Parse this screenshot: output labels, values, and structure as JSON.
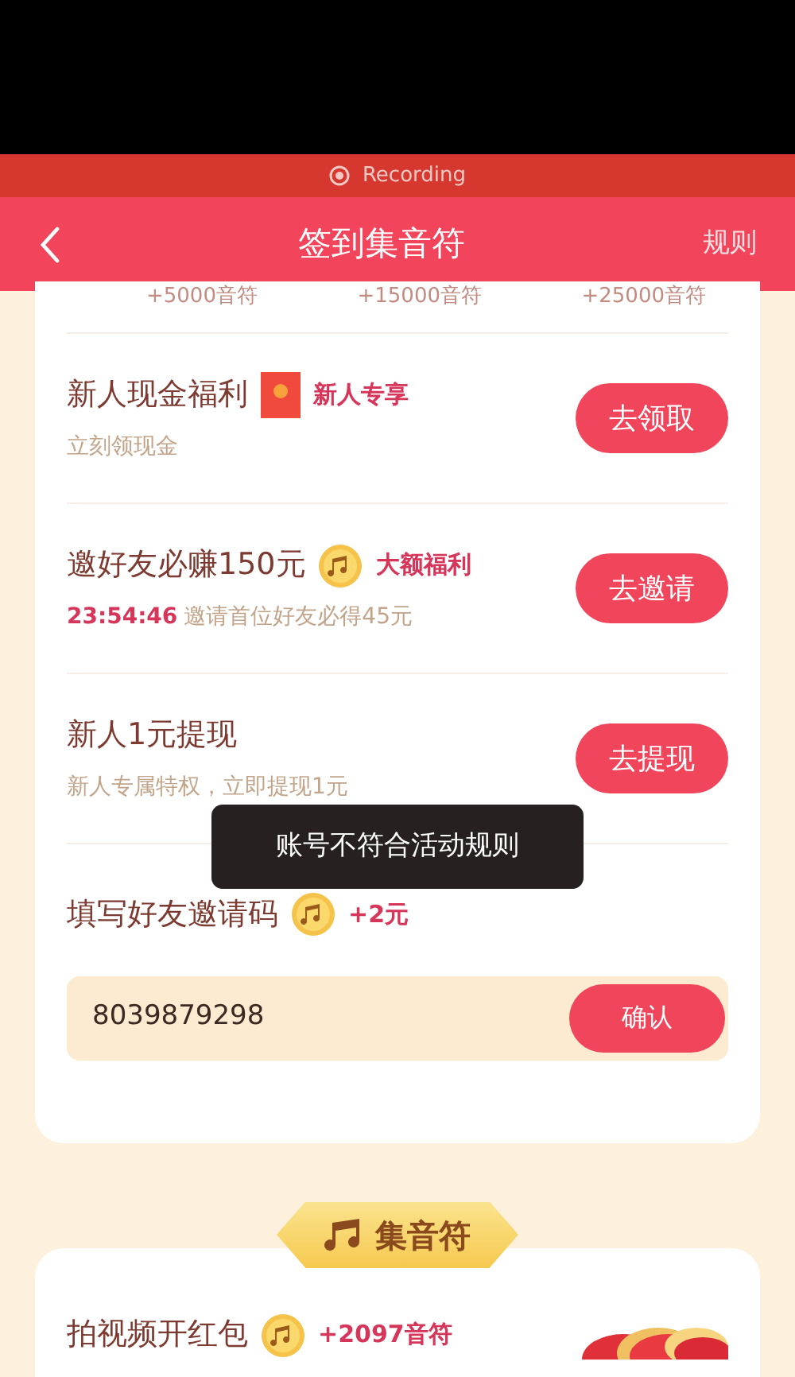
{
  "recording_bar": {
    "label": "Recording"
  },
  "nav": {
    "title": "签到集音符",
    "right": "规则"
  },
  "milestones": [
    "+5000音符",
    "+15000音符",
    "+25000音符"
  ],
  "tasks": [
    {
      "kind": "packet",
      "title": "新人现金福利",
      "tag": "新人专享",
      "subtitle": "立刻领现金",
      "button": "去领取"
    },
    {
      "kind": "coin",
      "title": "邀好友必赚150元",
      "tag": "大额福利",
      "countdown": "23:54:46",
      "subtitle": "邀请首位好友必得45元",
      "button": "去邀请"
    },
    {
      "kind": "plain",
      "title": "新人1元提现",
      "subtitle": "新人专属特权，立即提现1元",
      "button": "去提现"
    }
  ],
  "invite": {
    "kind": "coin",
    "title": "填写好友邀请码",
    "tag": "+2元",
    "value": "8039879298",
    "button": "确认"
  },
  "toast": "账号不符合活动规则",
  "section": {
    "title": "集音符"
  },
  "collect_tasks": [
    {
      "kind": "coin",
      "title": "拍视频开红包",
      "tag": "+2097音符"
    }
  ]
}
